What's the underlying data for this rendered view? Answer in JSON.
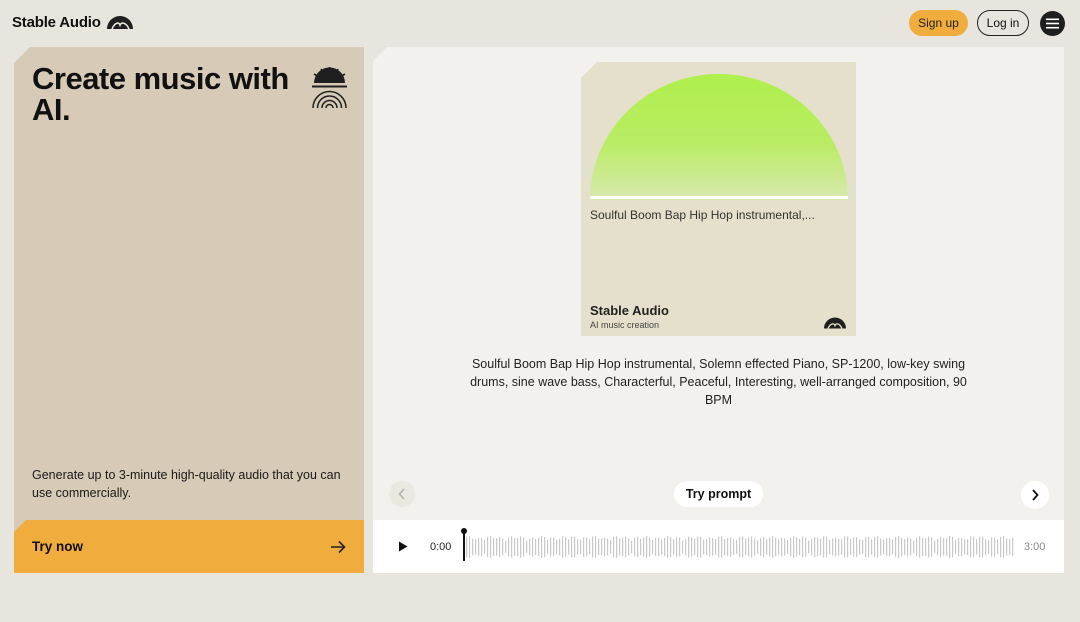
{
  "header": {
    "brand": "Stable Audio",
    "signup_label": "Sign up",
    "login_label": "Log in",
    "menu_icon": "hamburger-icon"
  },
  "hero": {
    "title": "Create music with AI.",
    "description": "Generate up to 3-minute high-quality audio that you can use commercially.",
    "cta_label": "Try now",
    "cta_icon": "arrow-right-icon"
  },
  "album": {
    "prompt_short": "Soulful Boom Bap Hip Hop instrumental,...",
    "brand": "Stable Audio",
    "subtitle": "AI music creation",
    "accent": "#b5f055"
  },
  "prompt": {
    "full_text": "Soulful Boom Bap Hip Hop instrumental, Solemn effected Piano, SP-1200, low-key swing drums, sine wave bass, Characterful, Peaceful, Interesting, well-arranged composition, 90 BPM",
    "try_label": "Try prompt"
  },
  "player": {
    "current_time": "0:00",
    "total_time": "3:00",
    "play_icon": "play-icon"
  },
  "colors": {
    "background": "#e8e5de",
    "card": "#d7cbb7",
    "accent": "#f0ac3c",
    "panel": "#f3f1ee"
  }
}
